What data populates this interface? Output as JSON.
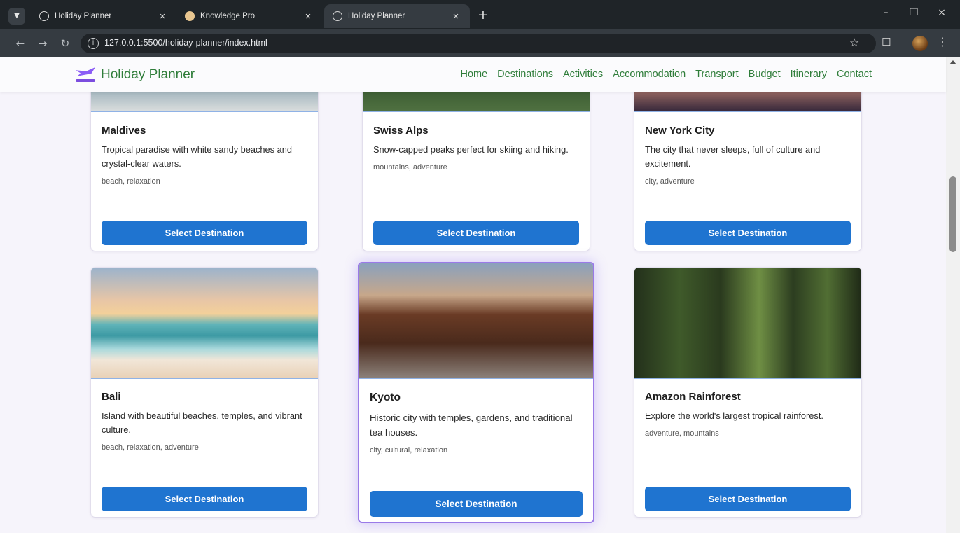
{
  "browser": {
    "tabs": [
      {
        "title": "Holiday Planner",
        "active": false
      },
      {
        "title": "Knowledge Pro",
        "active": false
      },
      {
        "title": "Holiday Planner",
        "active": true
      }
    ],
    "url": "127.0.0.1:5500/holiday-planner/index.html"
  },
  "site": {
    "brand": "Holiday Planner",
    "nav": [
      "Home",
      "Destinations",
      "Activities",
      "Accommodation",
      "Transport",
      "Budget",
      "Itinerary",
      "Contact"
    ]
  },
  "destinations": [
    {
      "name": "Maldives",
      "description": "Tropical paradise with white sandy beaches and crystal-clear waters.",
      "tags": "beach, relaxation",
      "button": "Select Destination"
    },
    {
      "name": "Swiss Alps",
      "description": "Snow-capped peaks perfect for skiing and hiking.",
      "tags": "mountains, adventure",
      "button": "Select Destination"
    },
    {
      "name": "New York City",
      "description": "The city that never sleeps, full of culture and excitement.",
      "tags": "city, adventure",
      "button": "Select Destination"
    },
    {
      "name": "Bali",
      "description": "Island with beautiful beaches, temples, and vibrant culture.",
      "tags": "beach, relaxation, adventure",
      "button": "Select Destination"
    },
    {
      "name": "Kyoto",
      "description": "Historic city with temples, gardens, and traditional tea houses.",
      "tags": "city, cultural, relaxation",
      "button": "Select Destination"
    },
    {
      "name": "Amazon Rainforest",
      "description": "Explore the world's largest tropical rainforest.",
      "tags": "adventure, mountains",
      "button": "Select Destination"
    }
  ],
  "colors": {
    "brand_green": "#2f7d3a",
    "button_blue": "#1f74d0",
    "highlight_purple": "#9a7ae8"
  }
}
